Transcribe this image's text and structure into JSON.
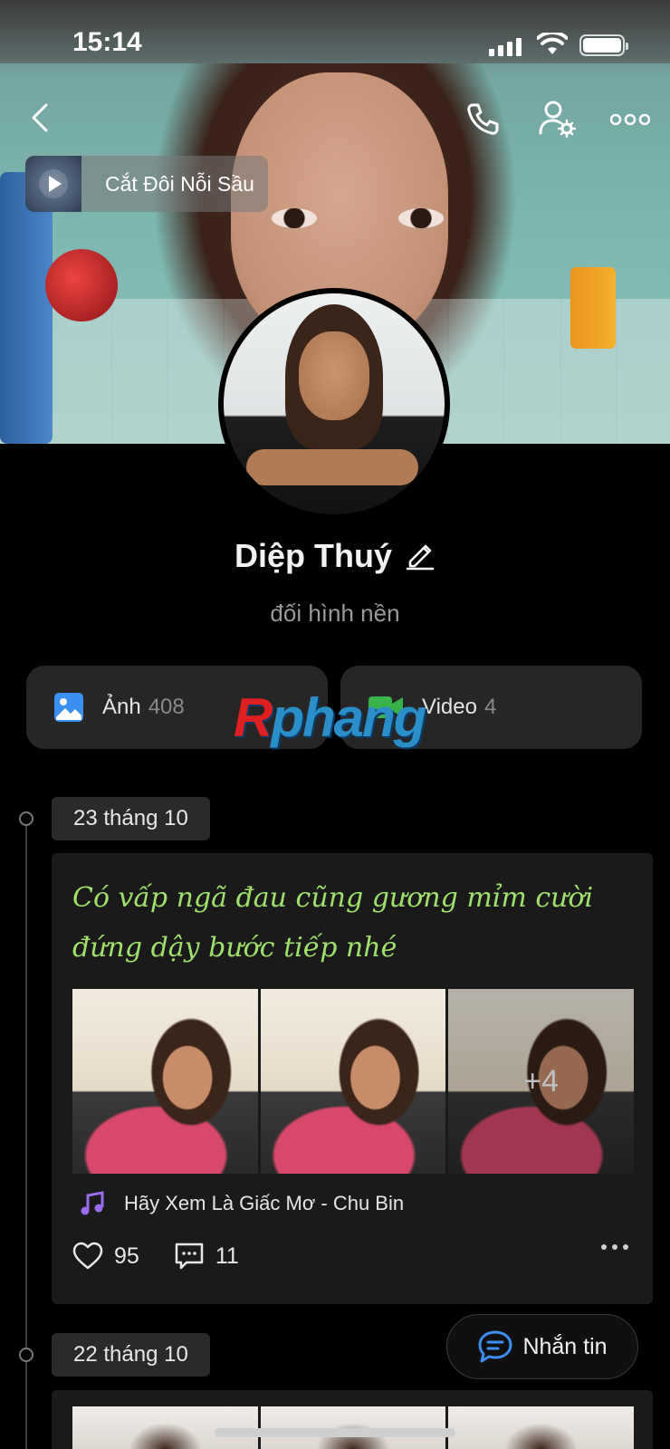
{
  "status_bar": {
    "time": "15:14"
  },
  "cover_music": {
    "title": "Cắt Đôi Nỗi Sầu"
  },
  "profile": {
    "name": "Diệp Thuý",
    "subtitle": "đối hình nền"
  },
  "media_tabs": [
    {
      "label": "Ảnh",
      "count": "408"
    },
    {
      "label": "Video",
      "count": "4"
    }
  ],
  "watermark": {
    "text_r": "R",
    "text_rest": "phang"
  },
  "timeline": [
    {
      "date": "23 tháng 10",
      "caption": "Có vấp ngã đau cũng gương mỉm cười đứng dậy bước tiếp nhé",
      "photos_more": "+4",
      "song": "Hãy Xem Là Giấc Mơ - Chu Bin",
      "likes": "95",
      "comments": "11"
    },
    {
      "date": "22 tháng 10"
    }
  ],
  "message_button": {
    "label": "Nhắn tin"
  },
  "colors": {
    "caption": "#9ee26a",
    "accent_blue": "#3a8ff0",
    "video_green": "#38b34a"
  }
}
